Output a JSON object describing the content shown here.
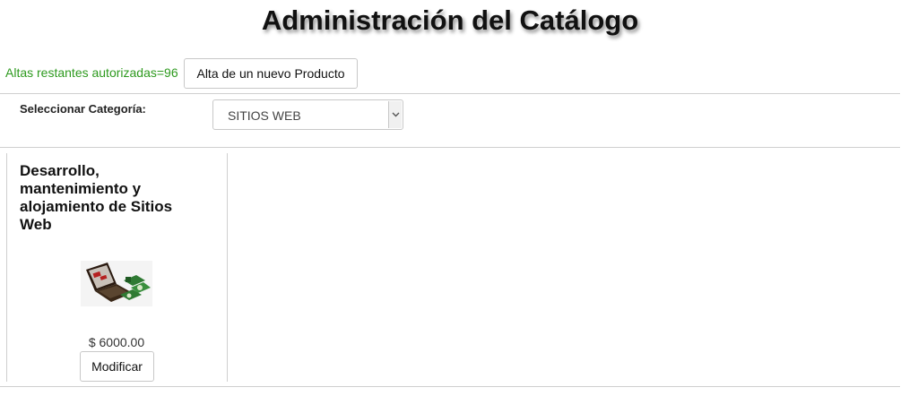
{
  "header": {
    "title": "Administración del Catálogo"
  },
  "toolbar": {
    "quota_text": "Altas restantes autorizadas=96",
    "new_product_label": "Alta de un nuevo Producto"
  },
  "category": {
    "label": "Seleccionar Categoría:",
    "selected": "SITIOS WEB"
  },
  "products": [
    {
      "title": "Desarrollo, mantenimiento y alojamiento de Sitios Web",
      "image_icon": "laptop-with-money-icon",
      "price": "$ 6000.00",
      "modify_label": "Modificar"
    }
  ],
  "colors": {
    "quota_green": "#2e9a1f",
    "border": "#c8c8c8"
  }
}
